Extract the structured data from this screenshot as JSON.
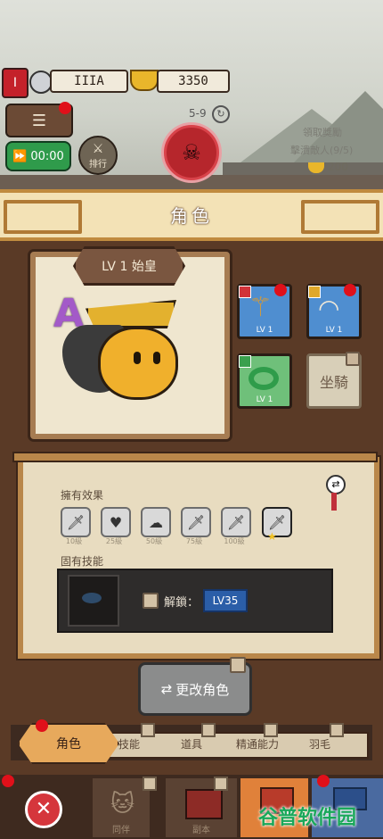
{
  "hud": {
    "gem_value": "IIIA",
    "gold_value": "3350",
    "timer": "00:00",
    "rank_label": "排行",
    "wave": "5-9"
  },
  "quest": {
    "title": "領取獎勵",
    "desc": "擊潰敵人(9/5)",
    "reward": "200"
  },
  "screen": {
    "title": "角色"
  },
  "character": {
    "level_label": "LV 1 始皇",
    "grade": "A"
  },
  "equipment": [
    {
      "name": "staff",
      "level": "LV 1"
    },
    {
      "name": "fan",
      "level": "LV 1"
    },
    {
      "name": "jade-bracelet",
      "level": "LV 1"
    },
    {
      "name": "mount",
      "label": "坐騎"
    }
  ],
  "effects": {
    "title": "擁有效果",
    "items": [
      {
        "icon": "sword",
        "threshold": "10級"
      },
      {
        "icon": "heart",
        "threshold": "25級"
      },
      {
        "icon": "ghost",
        "threshold": "50級"
      },
      {
        "icon": "sword",
        "threshold": "75級"
      },
      {
        "icon": "sword",
        "threshold": "100級"
      },
      {
        "icon": "sword",
        "threshold": ""
      }
    ]
  },
  "skill": {
    "title": "固有技能",
    "unlock_label": "解鎖：",
    "unlock_level": "LV35"
  },
  "buttons": {
    "change_character": "更改角色"
  },
  "tabs": [
    {
      "label": "角色",
      "active": true
    },
    {
      "label": "技能"
    },
    {
      "label": "道具"
    },
    {
      "label": "精通能力"
    },
    {
      "label": "羽毛"
    }
  ],
  "bottom_nav": [
    {
      "label": "",
      "icon": "close"
    },
    {
      "label": "同伴",
      "icon": "cat"
    },
    {
      "label": "副本",
      "icon": "gate"
    },
    {
      "label": "",
      "icon": "palace"
    },
    {
      "label": "",
      "icon": "shop"
    }
  ],
  "watermark": "谷普软件园",
  "colors": {
    "alert_red": "#e0101a",
    "banner_bg": "#f3e2b6",
    "wood": "#5a3a26",
    "level_blue": "#2b5ea8"
  }
}
